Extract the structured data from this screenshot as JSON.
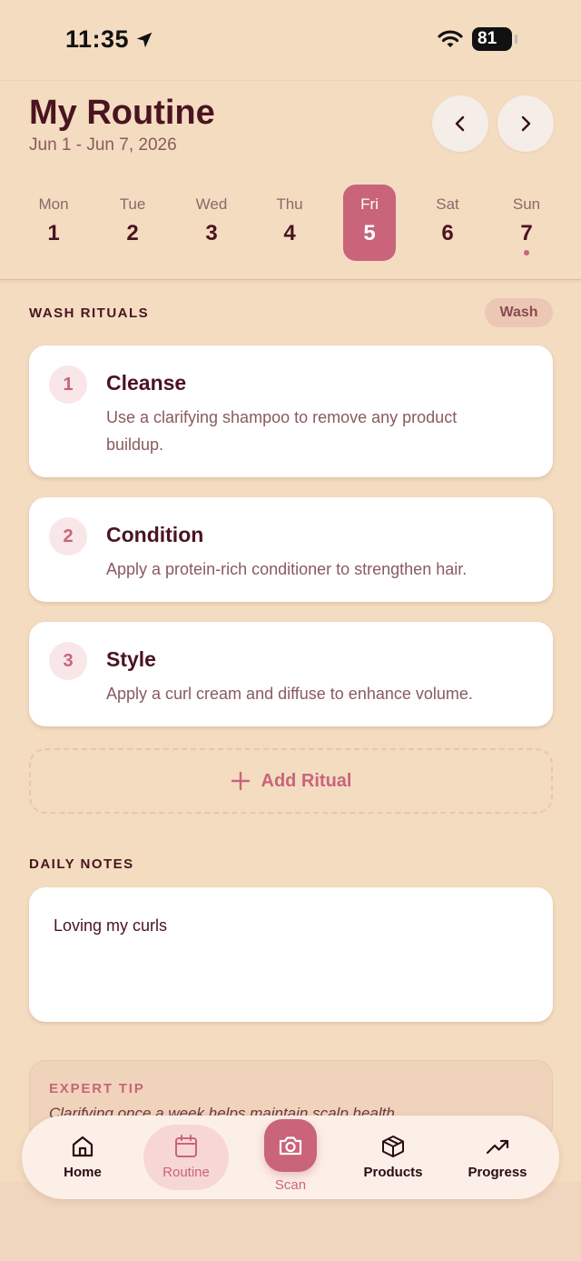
{
  "status": {
    "time": "11:35",
    "battery": "81"
  },
  "header": {
    "title": "My Routine",
    "date_range": "Jun 1 - Jun 7, 2026"
  },
  "week": [
    {
      "name": "Mon",
      "num": "1"
    },
    {
      "name": "Tue",
      "num": "2"
    },
    {
      "name": "Wed",
      "num": "3"
    },
    {
      "name": "Thu",
      "num": "4"
    },
    {
      "name": "Fri",
      "num": "5",
      "selected": true
    },
    {
      "name": "Sat",
      "num": "6"
    },
    {
      "name": "Sun",
      "num": "7",
      "has_entry": true
    }
  ],
  "wash": {
    "label": "WASH RITUALS",
    "badge": "Wash",
    "rituals": [
      {
        "num": "1",
        "title": "Cleanse",
        "desc": "Use a clarifying shampoo to remove any product buildup."
      },
      {
        "num": "2",
        "title": "Condition",
        "desc": "Apply a protein-rich conditioner to strengthen hair."
      },
      {
        "num": "3",
        "title": "Style",
        "desc": "Apply a curl cream and diffuse to enhance volume."
      }
    ],
    "add_label": "Add Ritual"
  },
  "notes": {
    "label": "DAILY NOTES",
    "text": "Loving my curls"
  },
  "tip": {
    "label": "EXPERT TIP",
    "text": "Clarifying once a week helps maintain scalp health."
  },
  "nav": {
    "home": "Home",
    "routine": "Routine",
    "scan": "Scan",
    "products": "Products",
    "progress": "Progress"
  },
  "colors": {
    "background": "#f4dcc1",
    "accent": "#c9647a",
    "text": "#4a1420"
  }
}
